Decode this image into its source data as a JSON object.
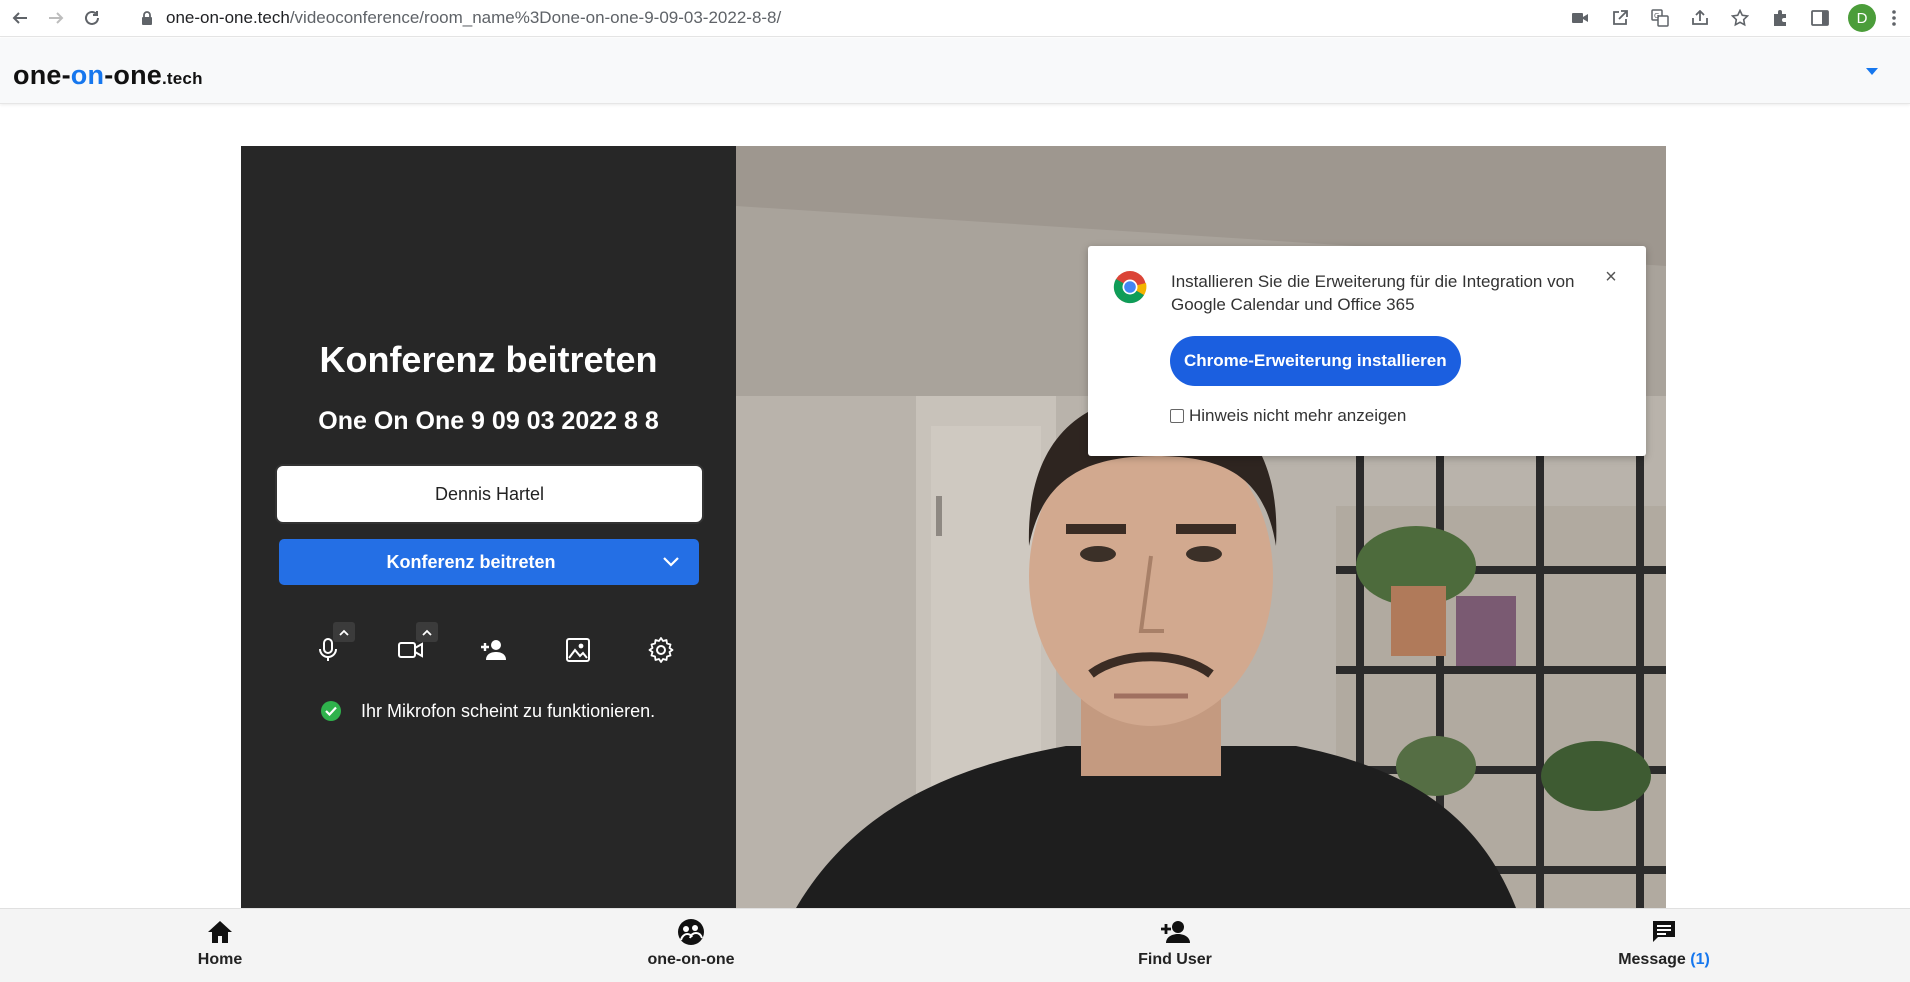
{
  "browser": {
    "url_host": "one-on-one.tech",
    "url_path": "/videoconference/room_name%3Done-on-one-9-09-03-2022-8-8/",
    "profile_initial": "D"
  },
  "header": {
    "logo_part1": "one-",
    "logo_part2": "on",
    "logo_part3": "-one",
    "logo_tld": ".tech"
  },
  "prejoin": {
    "title": "Konferenz beitreten",
    "room_name": "One On One 9 09 03 2022 8 8",
    "name_value": "Dennis Hartel",
    "join_label": "Konferenz beitreten",
    "status_text": "Ihr Mikrofon scheint zu funktionieren.",
    "tools": [
      "microphone-icon",
      "camera-icon",
      "invite-person-icon",
      "background-image-icon",
      "settings-gear-icon"
    ]
  },
  "extension_popup": {
    "message": "Installieren Sie die Erweiterung für die Integration von Google Calendar und Office 365",
    "install_label": "Chrome-Erweiterung installieren",
    "dont_show_label": "Hinweis nicht mehr anzeigen",
    "close_symbol": "×"
  },
  "bottom_nav": {
    "items": [
      {
        "label": "Home",
        "icon": "home-icon"
      },
      {
        "label": "one-on-one",
        "icon": "people-circle-icon"
      },
      {
        "label": "Find User",
        "icon": "add-person-icon"
      },
      {
        "label": "Message",
        "icon": "message-icon",
        "count": "(1)"
      }
    ]
  },
  "colors": {
    "accent": "#246fe5",
    "panel": "#272727",
    "logo_on": "#1677ee",
    "status_ok": "#2fb24c"
  }
}
